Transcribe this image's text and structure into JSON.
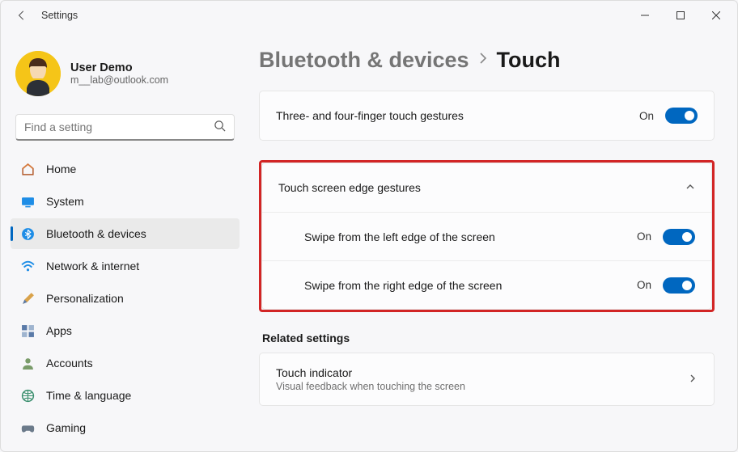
{
  "window": {
    "title": "Settings"
  },
  "profile": {
    "name": "User Demo",
    "email": "m__lab@outlook.com"
  },
  "search": {
    "placeholder": "Find a setting"
  },
  "sidebar": {
    "items": [
      {
        "label": "Home"
      },
      {
        "label": "System"
      },
      {
        "label": "Bluetooth & devices"
      },
      {
        "label": "Network & internet"
      },
      {
        "label": "Personalization"
      },
      {
        "label": "Apps"
      },
      {
        "label": "Accounts"
      },
      {
        "label": "Time & language"
      },
      {
        "label": "Gaming"
      }
    ]
  },
  "breadcrumb": {
    "parent": "Bluetooth & devices",
    "current": "Touch"
  },
  "settings": {
    "gestures": {
      "label": "Three- and four-finger touch gestures",
      "state": "On"
    },
    "edge": {
      "label": "Touch screen edge gestures",
      "left": {
        "label": "Swipe from the left edge of the screen",
        "state": "On"
      },
      "right": {
        "label": "Swipe from the right edge of the screen",
        "state": "On"
      }
    }
  },
  "related": {
    "heading": "Related settings",
    "touch_indicator": {
      "title": "Touch indicator",
      "subtitle": "Visual feedback when touching the screen"
    }
  },
  "colors": {
    "accent": "#0067c0",
    "highlight": "#d22525"
  }
}
